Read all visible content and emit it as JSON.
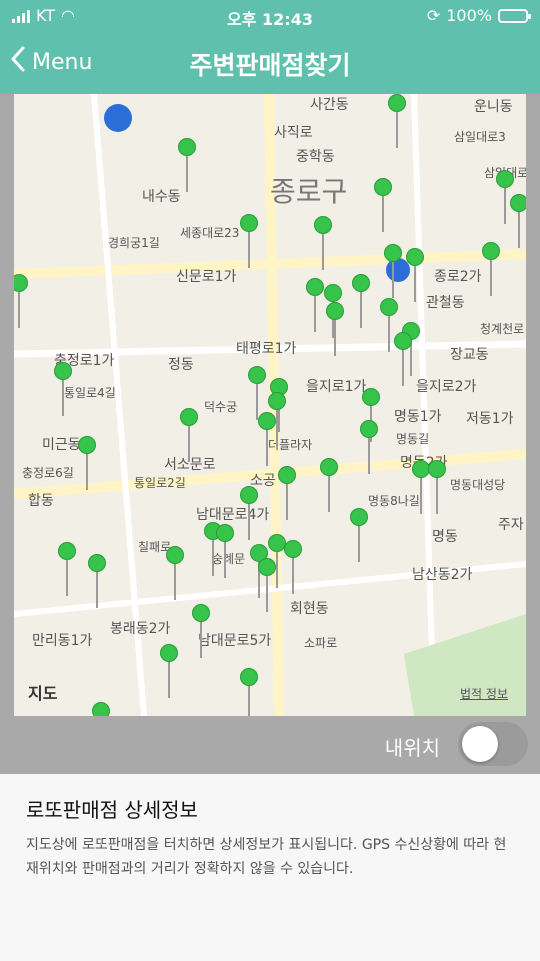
{
  "status": {
    "carrier": "KT",
    "time": "오후 12:43",
    "battery_percent": "100%"
  },
  "nav": {
    "back_label": "Menu",
    "title": "주변판매점찾기"
  },
  "map": {
    "labels": [
      "사간동",
      "운니동",
      "사직로",
      "삼일대로3",
      "중학동",
      "내수동",
      "종로구",
      "삼일대로",
      "세종대로23",
      "경희궁1길",
      "신문로1가",
      "종로2가",
      "관철동",
      "청계천로",
      "정동",
      "태평로1가",
      "장교동",
      "을지로1가",
      "을지로2가",
      "덕수궁",
      "명동1가",
      "저동1가",
      "미근동",
      "서소문로",
      "더플라자",
      "명동길",
      "충정로6길",
      "합동",
      "소공",
      "명동2가",
      "명동대성당",
      "남대문로4가",
      "명동8나길",
      "주자",
      "칠패로",
      "숭례문",
      "명동",
      "남산동2가",
      "만리동1가",
      "봉래동2가",
      "회현동",
      "남대문로5가",
      "소파로",
      "충정로1가",
      "통일로2길",
      "통일로4길"
    ],
    "logo_text": "지도",
    "legal_text": "법적 정보"
  },
  "my_location": {
    "label": "내위치",
    "toggle_on": false
  },
  "info": {
    "title": "로또판매점 상세정보",
    "description": "지도상에 로또판매점을 터치하면 상세정보가 표시됩니다. GPS 수신상황에 따라 현재위치와 판매점과의 거리가 정확하지 않을 수 있습니다."
  }
}
